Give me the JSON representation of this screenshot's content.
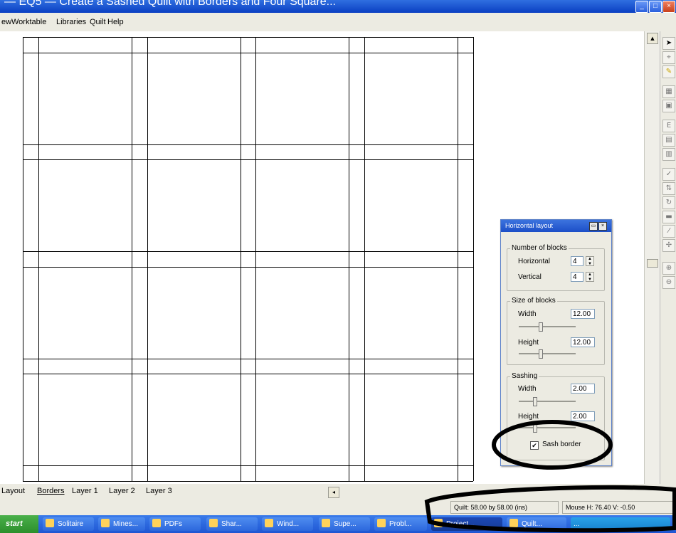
{
  "app": {
    "title": "— EQ5 — Create a Sashed Quilt with Borders and Four Square..."
  },
  "menu": {
    "items": [
      "ew",
      "Worktable",
      "Libraries",
      "Quilt",
      "Help"
    ]
  },
  "tabs": {
    "items": [
      "Layout",
      "Borders",
      "Layer 1",
      "Layer 2",
      "Layer 3"
    ]
  },
  "status": {
    "quilt_size": "Quilt:  58.00 by 58.00 (ins)",
    "mouse": "Mouse  H:  76.40   V:  -0.50"
  },
  "layout_panel": {
    "title": "Horizontal layout",
    "number_of_blocks": {
      "label": "Number of blocks",
      "horizontal_label": "Horizontal",
      "horizontal_value": "4",
      "vertical_label": "Vertical",
      "vertical_value": "4"
    },
    "size_of_blocks": {
      "label": "Size of blocks",
      "width_label": "Width",
      "width_value": "12.00",
      "height_label": "Height",
      "height_value": "12.00"
    },
    "sashing": {
      "label": "Sashing",
      "width_label": "Width",
      "width_value": "2.00",
      "height_label": "Height",
      "height_value": "2.00"
    },
    "sash_border": {
      "label": "Sash border",
      "checked": true,
      "check_mark": "✔"
    }
  },
  "taskbar": {
    "start_label": "start",
    "items": [
      "Solitaire",
      "Mines...",
      "PDFs",
      "Shar...",
      "Wind...",
      "Supe...",
      "Probl...",
      "Project...",
      "Quilt...",
      "..."
    ]
  },
  "toolbar": {
    "tools": [
      "pointer-icon",
      "pick-icon",
      "pencil-icon",
      "block-library-icon",
      "block-icon",
      "ep-icon",
      "eq-icon",
      "edit-icon",
      "spray-icon",
      "swap-icon",
      "rotate-icon",
      "fill-icon",
      "brush-icon",
      "eyedropper-icon",
      "zoom-in-icon",
      "zoom-out-icon"
    ]
  },
  "colors": {
    "title_bar": "#0a3fc2",
    "quilt_lines": "#000000",
    "panel_title": "#1c4fc8",
    "taskbar": "#1f56d3"
  }
}
